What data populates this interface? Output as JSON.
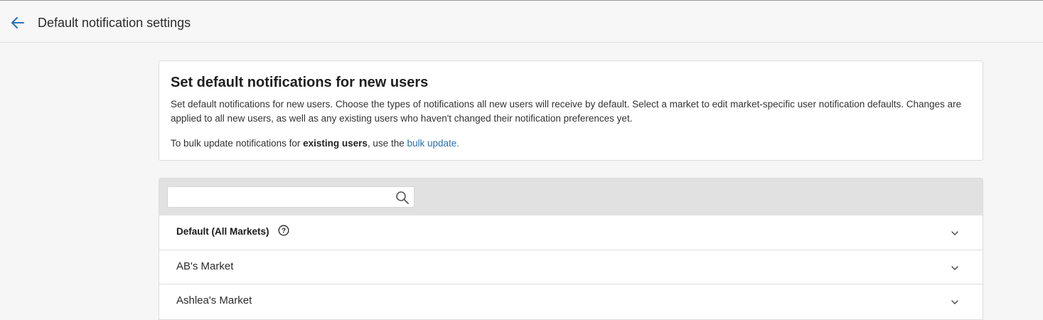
{
  "header": {
    "back_icon": "arrow-left-icon",
    "title": "Default notification settings"
  },
  "info": {
    "heading": "Set default notifications for new users",
    "description": "Set default notifications for new users. Choose the types of notifications all new users will receive by default. Select a market to edit market-specific user notification defaults. Changes are applied to all new users, as well as any existing users who haven't changed their notification preferences yet.",
    "bulk_prefix": "To bulk update notifications for ",
    "bulk_bold": "existing users",
    "bulk_middle": ", use the ",
    "bulk_link": "bulk update."
  },
  "search": {
    "value": "",
    "placeholder": "",
    "icon": "search-icon"
  },
  "markets": [
    {
      "name": "Default (All Markets)",
      "has_help": true,
      "bold": true,
      "icon": "chevron-down-icon"
    },
    {
      "name": "AB's Market",
      "has_help": false,
      "bold": false,
      "icon": "chevron-down-icon"
    },
    {
      "name": "Ashlea's Market",
      "has_help": false,
      "bold": false,
      "icon": "chevron-down-icon"
    }
  ],
  "colors": {
    "accent_link": "#2a6fb5",
    "back_arrow": "#2a6fb5",
    "search_bar_bg": "#e1e1e1"
  }
}
